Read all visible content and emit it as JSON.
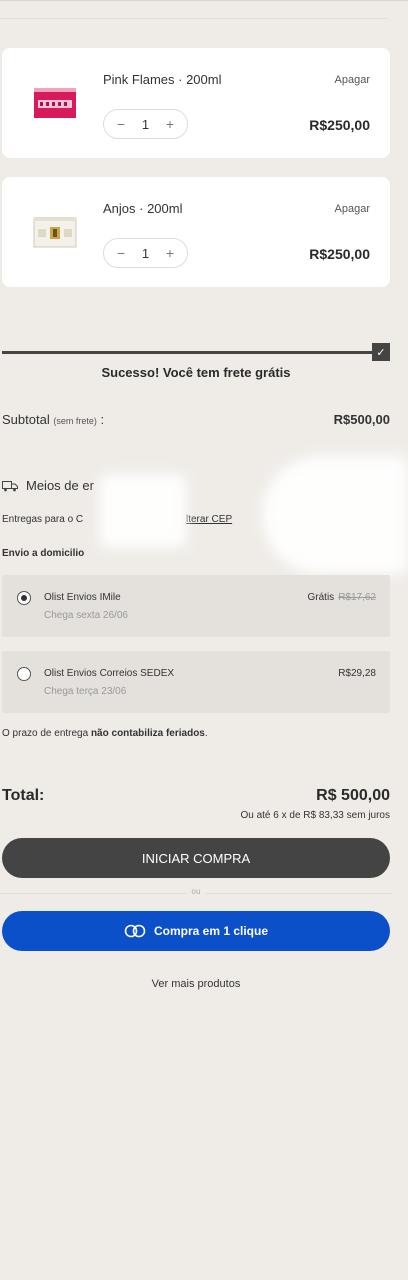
{
  "cart": {
    "items": [
      {
        "name": "Pink Flames · 200ml",
        "quantity": "1",
        "price": "R$250,00",
        "remove_label": "Apagar",
        "decrement": "−",
        "increment": "+"
      },
      {
        "name": "Anjos · 200ml",
        "quantity": "1",
        "price": "R$250,00",
        "remove_label": "Apagar",
        "decrement": "−",
        "increment": "+"
      }
    ]
  },
  "free_shipping": {
    "progress": 1.0,
    "check": "✓",
    "message": "Sucesso! Você tem frete grátis"
  },
  "subtotal": {
    "label": "Subtotal",
    "note": "(sem frete)",
    "colon": " :",
    "value": "R$500,00"
  },
  "shipping": {
    "title": "Meios de er",
    "collapse": "−",
    "delivery_to": "Entregas para o C",
    "change_cep": "lterar CEP",
    "home_delivery": "Envio a domicilio",
    "options": [
      {
        "name": "Olist Envios IMile",
        "eta": "Chega sexta 26/06",
        "price": "Grátis",
        "old_price": "R$17,62",
        "selected": true
      },
      {
        "name": "Olist Envios Correios SEDEX",
        "eta": "Chega terça 23/06",
        "price": "R$29,28",
        "old_price": "",
        "selected": false
      }
    ],
    "holiday_note_prefix": "O prazo de entrega ",
    "holiday_note_bold": "não contabiliza feriados",
    "holiday_note_suffix": "."
  },
  "total": {
    "label": "Total:",
    "value": "R$ 500,00",
    "installments": "Ou até 6 x de R$ 83,33 sem juros"
  },
  "actions": {
    "start_purchase": "INICIAR COMPRA",
    "or": "ou",
    "one_click": "Compra em 1 clique",
    "more_products": "Ver mais produtos"
  },
  "colors": {
    "background": "#efece8",
    "dark_button": "#444444",
    "brand_blue": "#0b50c9"
  }
}
